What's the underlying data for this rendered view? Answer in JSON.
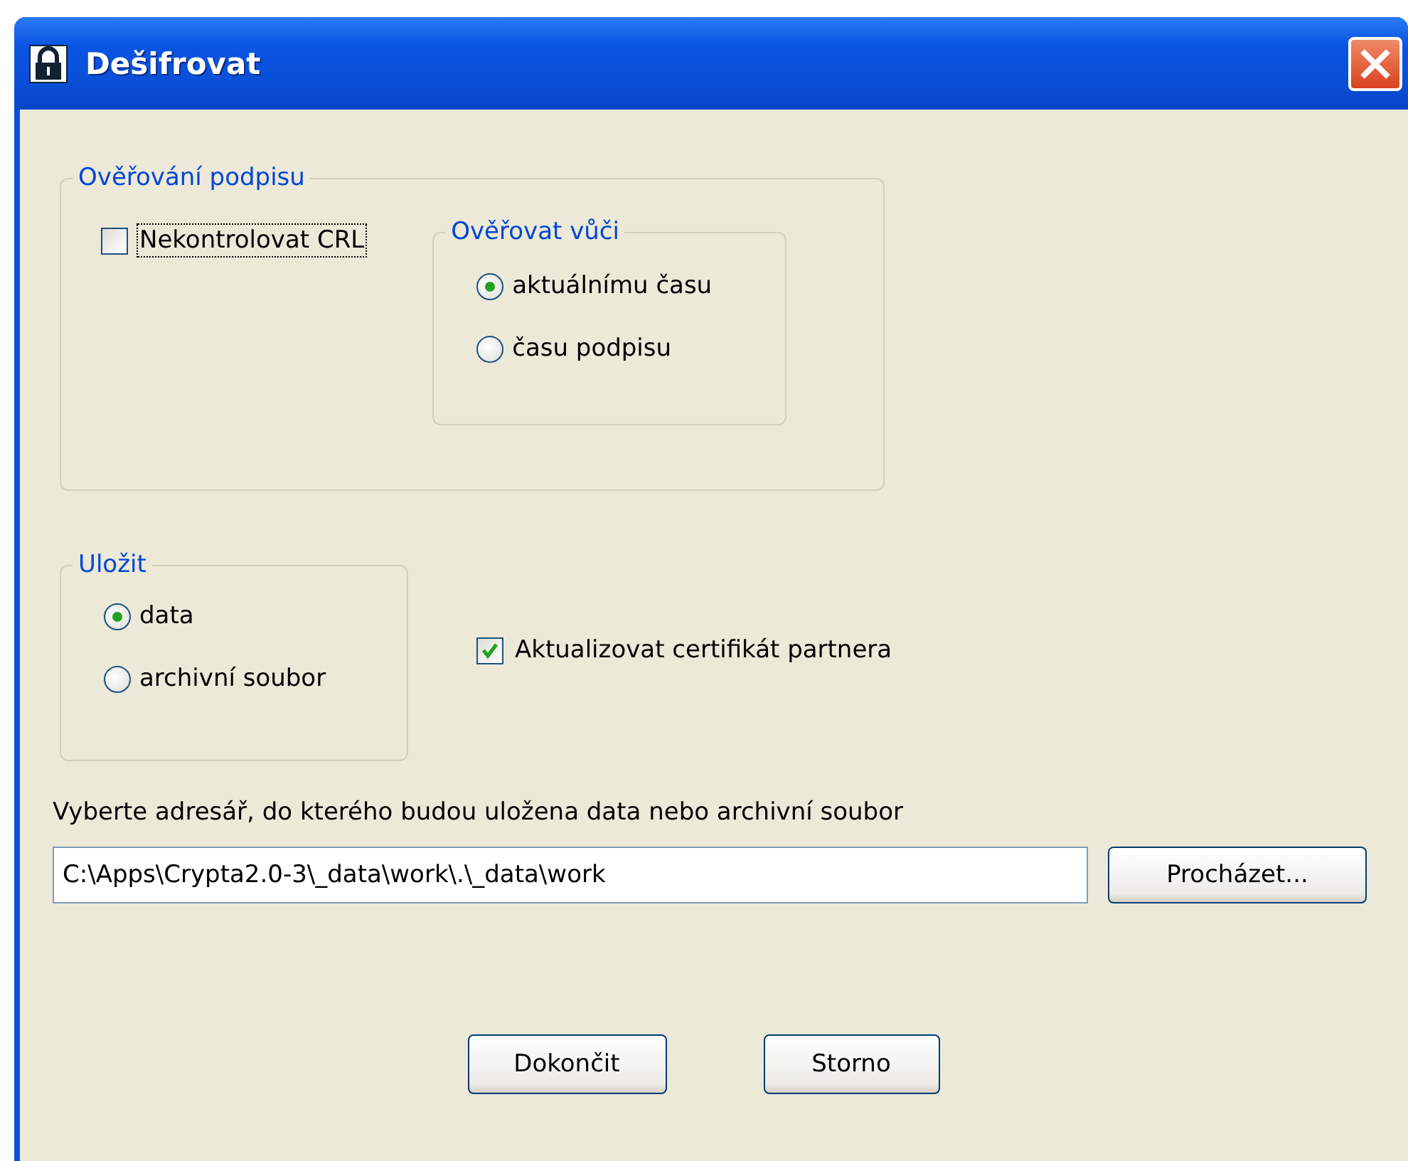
{
  "window": {
    "title": "Dešifrovat"
  },
  "signature_group": {
    "title": "Ověřování podpisu",
    "skip_crl": {
      "label": "Nekontrolovat CRL",
      "checked": false,
      "focused": true
    },
    "verify_against": {
      "title": "Ověřovat vůči",
      "options": [
        {
          "label": "aktuálnímu času",
          "selected": true
        },
        {
          "label": "času podpisu",
          "selected": false
        }
      ]
    }
  },
  "save_group": {
    "title": "Uložit",
    "options": [
      {
        "label": "data",
        "selected": true
      },
      {
        "label": "archivní soubor",
        "selected": false
      }
    ]
  },
  "update_certificate": {
    "label": "Aktualizovat certifikát partnera",
    "checked": true,
    "focused": false
  },
  "directory": {
    "label": "Vyberte adresář, do kterého budou uložena data nebo archivní soubor",
    "value": "C:\\Apps\\Crypta2.0-3\\_data\\work\\.\\_data\\work",
    "browse_button": "Procházet..."
  },
  "buttons": [
    "Dokončit",
    "Storno"
  ]
}
